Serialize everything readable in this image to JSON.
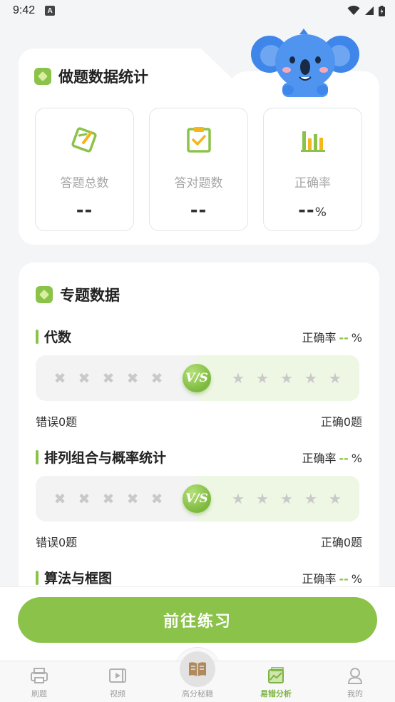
{
  "status_bar": {
    "time": "9:42",
    "a_badge": "A"
  },
  "stats": {
    "title": "做题数据统计",
    "items": [
      {
        "label": "答题总数",
        "value": "--",
        "icon": "pencil-square-icon"
      },
      {
        "label": "答对题数",
        "value": "--",
        "icon": "check-clipboard-icon"
      },
      {
        "label": "正确率",
        "value": "--",
        "unit": "%",
        "icon": "bar-chart-icon"
      }
    ]
  },
  "topics": {
    "title": "专题数据",
    "rate_label": "正确率",
    "rate_value": "--",
    "rate_unit": "%",
    "vs_label": "V/S",
    "items": [
      {
        "name": "代数",
        "wrong": "错误0题",
        "right": "正确0题"
      },
      {
        "name": "排列组合与概率统计",
        "wrong": "错误0题",
        "right": "正确0题"
      },
      {
        "name": "算法与框图"
      }
    ]
  },
  "cta": {
    "label": "前往练习"
  },
  "tabbar": {
    "items": [
      {
        "label": "刷题",
        "active": false
      },
      {
        "label": "视频",
        "active": false
      },
      {
        "label": "高分秘籍",
        "active": false
      },
      {
        "label": "易错分析",
        "active": true
      },
      {
        "label": "我的",
        "active": false
      }
    ]
  },
  "colors": {
    "accent": "#8bc34a",
    "active_tab": "#7cb342"
  }
}
